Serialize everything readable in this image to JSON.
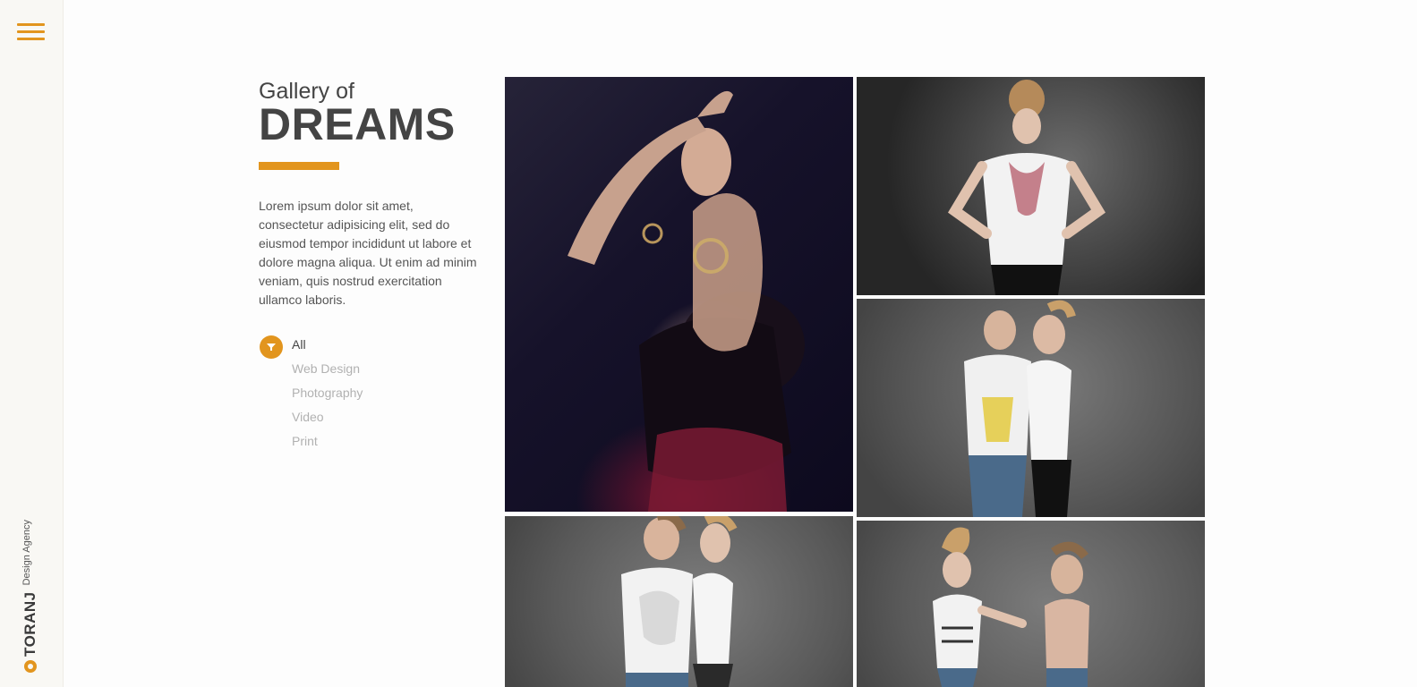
{
  "brand": {
    "name": "TORANJ",
    "tagline": "Design Agency",
    "accent_color": "#e2951e"
  },
  "menu": {
    "icon": "hamburger-menu-icon"
  },
  "intro": {
    "title_small": "Gallery of",
    "title_big": "DREAMS",
    "description": "Lorem ipsum dolor sit amet, consectetur adipisicing elit, sed do eiusmod tempor incididunt ut labore et dolore magna aliqua. Ut enim ad minim veniam, quis nostrud exercitation ullamco laboris."
  },
  "filters": {
    "icon": "filter-icon",
    "items": [
      {
        "label": "All",
        "active": true
      },
      {
        "label": "Web Design",
        "active": false
      },
      {
        "label": "Photography",
        "active": false
      },
      {
        "label": "Video",
        "active": false
      },
      {
        "label": "Print",
        "active": false
      }
    ]
  },
  "gallery": {
    "items": [
      {
        "alt": "woman in black lace top and red corset"
      },
      {
        "alt": "woman in white t-shirt posing"
      },
      {
        "alt": "couple in white t-shirts laughing"
      },
      {
        "alt": "couple in white t-shirts back to back"
      },
      {
        "alt": "couple playfully shouting"
      }
    ]
  }
}
